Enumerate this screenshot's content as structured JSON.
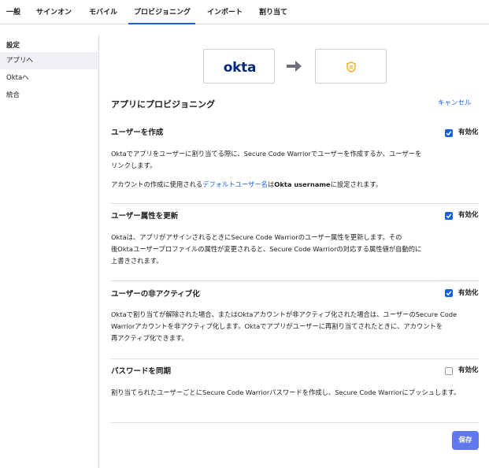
{
  "tabs": [
    "一般",
    "サインオン",
    "モバイル",
    "プロビジョニング",
    "インポート",
    "割り当て"
  ],
  "active_tab": "プロビジョニング",
  "sidebar": {
    "heading": "設定",
    "items": [
      {
        "label": "アプリへ",
        "selected": true
      },
      {
        "label": "Oktaへ",
        "selected": false
      },
      {
        "label": "統合",
        "selected": false
      }
    ]
  },
  "logos": {
    "source": "okta",
    "target_icon": "secure-code-warrior-shield-icon",
    "arrow_icon": "arrow-right-icon"
  },
  "panel": {
    "title": "アプリにプロビジョニング",
    "cancel_label": "キャンセル"
  },
  "sections": [
    {
      "title": "ユーザーを作成",
      "checked": true,
      "enabled_label": "有効化",
      "desc1": "Oktaでアプリをユーザーに割り当てる際に、Secure Code Warriorでユーザーを作成するか、ユーザーを",
      "desc2": "リンクします。",
      "desc3_pre": "アカウントの作成に使用される",
      "desc3_link": "デフォルトユーザー名",
      "desc3_mid": "は",
      "desc3_bold": "Okta username",
      "desc3_post": "に設定されます。"
    },
    {
      "title": "ユーザー属性を更新",
      "checked": true,
      "enabled_label": "有効化",
      "desc1": "Oktaは、アプリがアサインされるときにSecure Code Warriorのユーザー属性を更新します。その",
      "desc2": "後Oktaユーザープロファイルの属性が変更されると、Secure Code Warriorの対応する属性値が自動的に",
      "desc3": "上書きされます。"
    },
    {
      "title": "ユーザーの非アクティブ化",
      "checked": true,
      "enabled_label": "有効化",
      "desc1": "Oktaで割り当てが解除された場合、またはOktaアカウントが非アクティブ化された場合は、ユーザーのSecure Code",
      "desc2": "Warriorアカウントを非アクティブ化します。Oktaでアプリがユーザーに再割り当てされたときに、アカウントを",
      "desc3": "再アクティブ化できます。"
    },
    {
      "title": "パスワードを同期",
      "checked": false,
      "enabled_label": "有効化",
      "desc1": "割り当てられたユーザーごとにSecure Code Warriorパスワードを作成し、Secure Code Warriorにプッシュします。"
    }
  ],
  "save_label": "保存",
  "colors": {
    "accent": "#1662dd",
    "okta_brand": "#00297a",
    "scw_brand": "#f5a623",
    "save_button": "#6177ee",
    "selected_bg": "#eef0f6"
  }
}
